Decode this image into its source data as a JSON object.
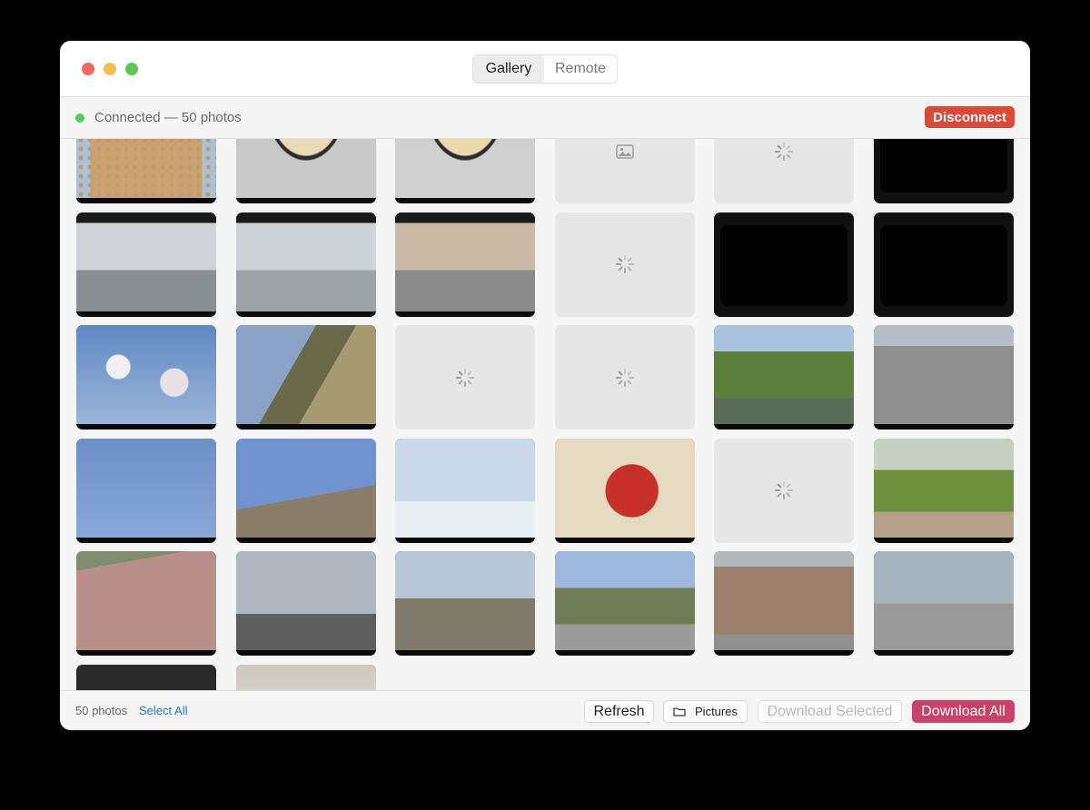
{
  "titlebar": {
    "tabs": [
      {
        "label": "Gallery",
        "active": true
      },
      {
        "label": "Remote",
        "active": false
      }
    ]
  },
  "status": {
    "text": "Connected — 50 photos",
    "dot_color": "#5ac85a",
    "disconnect_label": "Disconnect"
  },
  "grid": {
    "tiles": [
      {
        "state": "photo",
        "name": "photo-perforated-board"
      },
      {
        "state": "photo",
        "name": "photo-wire-basket"
      },
      {
        "state": "photo",
        "name": "photo-wire-basket-2"
      },
      {
        "state": "placeholder",
        "icon": "image-icon"
      },
      {
        "state": "loading"
      },
      {
        "state": "blank"
      },
      {
        "state": "photo",
        "name": "photo-mall-interior"
      },
      {
        "state": "photo",
        "name": "photo-mall-corridor"
      },
      {
        "state": "photo",
        "name": "photo-mall-shops"
      },
      {
        "state": "loading"
      },
      {
        "state": "blank"
      },
      {
        "state": "blank"
      },
      {
        "state": "photo",
        "name": "photo-blossom-branches"
      },
      {
        "state": "photo",
        "name": "photo-blossom-tree"
      },
      {
        "state": "loading"
      },
      {
        "state": "loading"
      },
      {
        "state": "photo",
        "name": "photo-park-trees"
      },
      {
        "state": "photo",
        "name": "photo-parking-lot"
      },
      {
        "state": "photo",
        "name": "photo-sky-wires"
      },
      {
        "state": "photo",
        "name": "photo-sky-rooftop"
      },
      {
        "state": "photo",
        "name": "photo-snowman-mural"
      },
      {
        "state": "photo",
        "name": "photo-wall-emblem"
      },
      {
        "state": "loading"
      },
      {
        "state": "photo",
        "name": "photo-sidewalk-trees"
      },
      {
        "state": "photo",
        "name": "photo-shadow-wall"
      },
      {
        "state": "photo",
        "name": "photo-apartment-block"
      },
      {
        "state": "photo",
        "name": "photo-street-sign"
      },
      {
        "state": "photo",
        "name": "photo-tree-lined-road"
      },
      {
        "state": "photo",
        "name": "photo-old-building"
      },
      {
        "state": "photo",
        "name": "photo-street-cyclist"
      },
      {
        "state": "photo",
        "name": "photo-storefront"
      },
      {
        "state": "photo",
        "name": "photo-room-interior"
      }
    ]
  },
  "footer": {
    "count_label": "50 photos",
    "select_all_label": "Select All",
    "refresh_label": "Refresh",
    "folder_label": "Pictures",
    "download_selected_label": "Download Selected",
    "download_all_label": "Download All"
  },
  "colors": {
    "accent": "#c8426a",
    "danger": "#d84a3a",
    "link": "#2a6fd1"
  }
}
